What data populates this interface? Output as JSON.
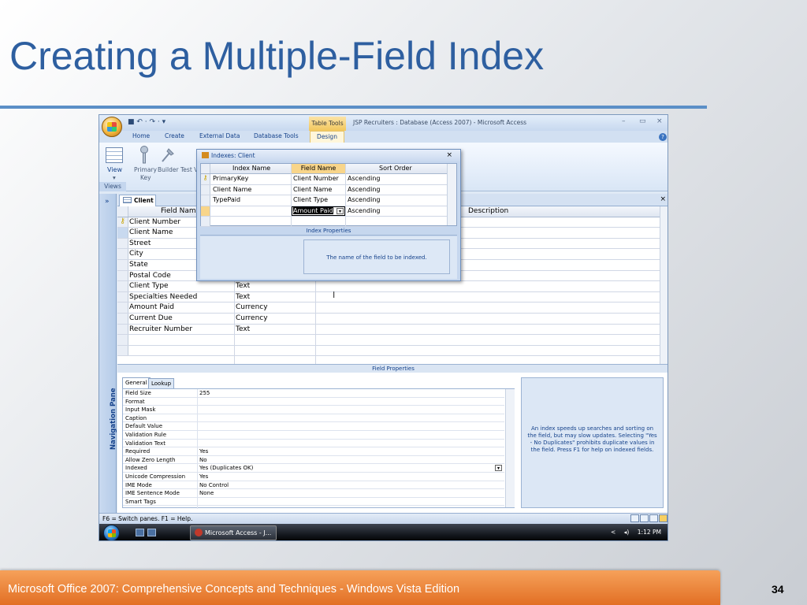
{
  "slide": {
    "title": "Creating a Multiple-Field Index",
    "footer": "Microsoft Office 2007: Comprehensive Concepts and Techniques - Windows Vista Edition",
    "page_number": "34"
  },
  "window": {
    "qat": "■ ↶ · ↷ · ▾",
    "table_tools": "Table Tools",
    "title": "JSP Recruiters : Database (Access 2007) - Microsoft Access",
    "min": "–",
    "max": "▭",
    "close": "×"
  },
  "ribbon": {
    "tabs": [
      "Home",
      "Create",
      "External Data",
      "Database Tools",
      "Design"
    ],
    "view_label": "View",
    "primary_key_label": "Primary",
    "primary_key_label2": "Key",
    "builder_label": "Builder",
    "test_label": "Test V",
    "views_group": "Views"
  },
  "nav": {
    "chevron": "»",
    "label": "Navigation Pane"
  },
  "document": {
    "tab": "Client",
    "close": "×",
    "headers": [
      "Field Nam",
      "",
      "Description"
    ],
    "rows": [
      {
        "name": "Client Number",
        "type": ""
      },
      {
        "name": "Client Name",
        "type": ""
      },
      {
        "name": "Street",
        "type": ""
      },
      {
        "name": "City",
        "type": ""
      },
      {
        "name": "State",
        "type": ""
      },
      {
        "name": "Postal Code",
        "type": ""
      },
      {
        "name": "Client Type",
        "type": "Text"
      },
      {
        "name": "Specialties Needed",
        "type": "Text"
      },
      {
        "name": "Amount Paid",
        "type": "Currency"
      },
      {
        "name": "Current Due",
        "type": "Currency"
      },
      {
        "name": "Recruiter Number",
        "type": "Text"
      }
    ]
  },
  "field_properties": {
    "label": "Field Properties",
    "tabs": [
      "General",
      "Lookup"
    ],
    "rows": [
      {
        "label": "Field Size",
        "value": "255"
      },
      {
        "label": "Format",
        "value": ""
      },
      {
        "label": "Input Mask",
        "value": ""
      },
      {
        "label": "Caption",
        "value": ""
      },
      {
        "label": "Default Value",
        "value": ""
      },
      {
        "label": "Validation Rule",
        "value": ""
      },
      {
        "label": "Validation Text",
        "value": ""
      },
      {
        "label": "Required",
        "value": "Yes"
      },
      {
        "label": "Allow Zero Length",
        "value": "No"
      },
      {
        "label": "Indexed",
        "value": "Yes (Duplicates OK)"
      },
      {
        "label": "Unicode Compression",
        "value": "Yes"
      },
      {
        "label": "IME Mode",
        "value": "No Control"
      },
      {
        "label": "IME Sentence Mode",
        "value": "None"
      },
      {
        "label": "Smart Tags",
        "value": ""
      }
    ],
    "help": "An index speeds up searches and sorting on the field, but may slow updates. Selecting \"Yes - No Duplicates\" prohibits duplicate values in the field. Press F1 for help on indexed fields."
  },
  "indexes_dialog": {
    "title": "Indexes: Client",
    "close": "×",
    "headers": [
      "Index Name",
      "Field Name",
      "Sort Order"
    ],
    "rows": [
      {
        "index": "PrimaryKey",
        "field": "Client Number",
        "sort": "Ascending"
      },
      {
        "index": "Client Name",
        "field": "Client Name",
        "sort": "Ascending"
      },
      {
        "index": "TypePaid",
        "field": "Client Type",
        "sort": "Ascending"
      },
      {
        "index": "",
        "field": "Amount Paid",
        "sort": "Ascending"
      }
    ],
    "props_label": "Index Properties",
    "props_help": "The name of the field to be indexed."
  },
  "statusbar": {
    "text": "F6 = Switch panes.  F1 = Help."
  },
  "taskbar": {
    "app_button": "Microsoft Access - J...",
    "back": "<",
    "speaker": "◂)",
    "clock": "1:12 PM"
  },
  "colors": {
    "title": "#2e5fa0",
    "footer": "#e26f24",
    "accent_design_tab": "#fff6da"
  }
}
